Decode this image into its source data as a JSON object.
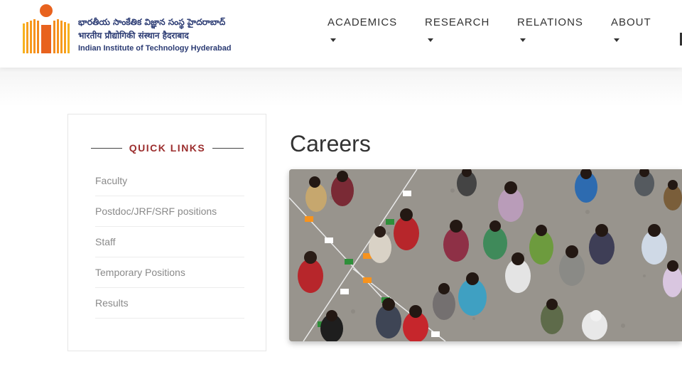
{
  "header": {
    "logo": {
      "line1": "భారతీయ సాంకేతిక విజ్ఞాన సంస్థ హైదరాబాద్",
      "line2": "भारतीय प्रौद्योगिकी संस्थान हैदराबाद",
      "line3": "Indian Institute of Technology Hyderabad"
    },
    "nav": [
      {
        "label": "ACADEMICS"
      },
      {
        "label": "RESEARCH"
      },
      {
        "label": "RELATIONS"
      },
      {
        "label": "ABOUT"
      }
    ]
  },
  "sidebar": {
    "heading": "QUICK LINKS",
    "items": [
      {
        "label": "Faculty"
      },
      {
        "label": "Postdoc/JRF/SRF positions"
      },
      {
        "label": "Staff"
      },
      {
        "label": "Temporary Positions"
      },
      {
        "label": "Results"
      }
    ]
  },
  "main": {
    "title": "Careers"
  },
  "colors": {
    "brand_blue": "#2b3b73",
    "logo_orange": "#f7931e",
    "heading_red": "#9b2d2d"
  }
}
